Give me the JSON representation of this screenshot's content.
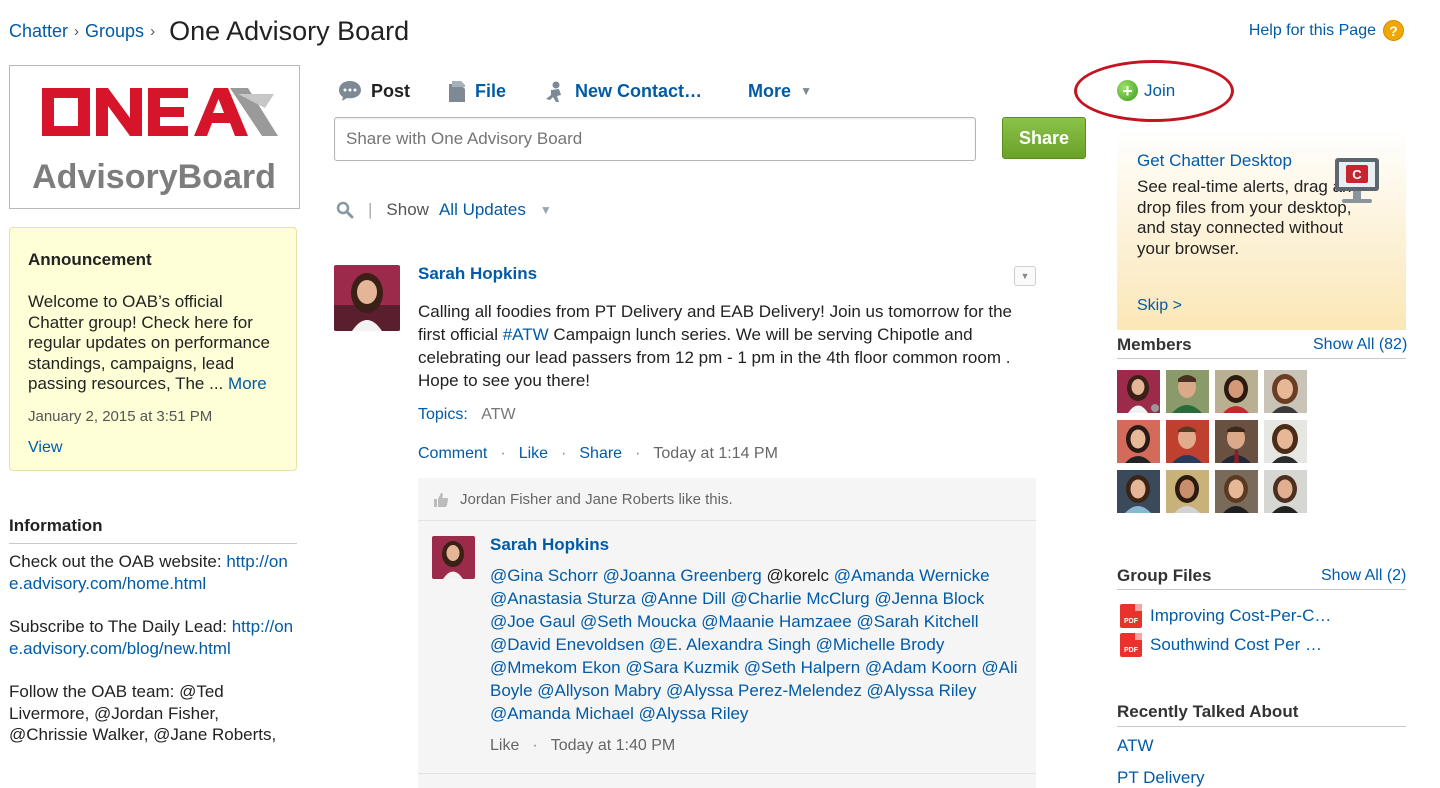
{
  "breadcrumb": {
    "chatter": "Chatter",
    "groups": "Groups",
    "title": "One Advisory Board"
  },
  "help": {
    "label": "Help for this Page"
  },
  "logo": {
    "top": "ONE",
    "bottom": "AdvisoryBoard",
    "colors": {
      "red": "#d7152a",
      "gray": "#7d7d7d"
    }
  },
  "announcement": {
    "heading": "Announcement",
    "body": "Welcome to OAB’s official Chatter group! Check here for regular updates on performance standings, campaigns, lead passing resources, The ...",
    "more": "More",
    "date": "January 2, 2015 at 3:51 PM",
    "view": "View"
  },
  "information": {
    "heading": "Information",
    "p1_text": "Check out the OAB website: ",
    "p1_link": "http://one.advisory.com/home.html",
    "p2_text": "Subscribe to The Daily Lead: ",
    "p2_link": "http://one.advisory.com/blog/new.html",
    "p3_text": "Follow the OAB team: @Ted Livermore, @Jordan Fisher, @Chrissie Walker, @Jane Roberts,"
  },
  "publisher": {
    "tabs": [
      "Post",
      "File",
      "New Contact…",
      "More"
    ],
    "placeholder": "Share with One Advisory Board",
    "share": "Share"
  },
  "filter": {
    "show": "Show",
    "value": "All Updates"
  },
  "post": {
    "author": "Sarah Hopkins",
    "text_before": "Calling all foodies from PT Delivery and EAB Delivery! Join us tomorrow for the first official ",
    "hashtag": "#ATW",
    "text_after": " Campaign lunch series. We will be serving Chipotle and celebrating our lead passers from 12 pm - 1 pm in the 4th floor common room . Hope to see you there!",
    "topics_label": "Topics:",
    "topic": "ATW",
    "actions": {
      "comment": "Comment",
      "like": "Like",
      "share": "Share",
      "time": "Today at 1:14 PM"
    },
    "likes": "Jordan Fisher and Jane Roberts like this."
  },
  "comment": {
    "author": "Sarah Hopkins",
    "mentions_a": "@Gina Schorr @Joanna Greenberg",
    "plain": " @korelc ",
    "mentions_b": "@Amanda Wernicke @Anastasia Sturza @Anne Dill @Charlie McClurg @Jenna Block @Joe Gaul @Seth Moucka @Maanie Hamzaee @Sarah Kitchell @David Enevoldsen @E. Alexandra Singh @Michelle Brody @Mmekom Ekon @Sara Kuzmik @Seth Halpern @Adam Koorn @Ali Boyle @Allyson Mabry @Alyssa Perez-Melendez @Alyssa Riley @Amanda Michael @Alyssa Riley",
    "like": "Like",
    "time": "Today at 1:40 PM"
  },
  "join": {
    "label": "Join"
  },
  "desktop": {
    "title": "Get Chatter Desktop",
    "text": "See real-time alerts, drag and drop files from your desktop, and stay connected without your browser.",
    "skip": "Skip >"
  },
  "members": {
    "title": "Members",
    "show_all": "Show All (82)"
  },
  "files": {
    "title": "Group Files",
    "show_all": "Show All (2)",
    "items": [
      "Improving Cost-Per-C…",
      "Southwind Cost Per …"
    ]
  },
  "recent": {
    "title": "Recently Talked About",
    "items": [
      "ATW",
      "PT Delivery"
    ]
  },
  "icons": [
    "chevron-right-icon",
    "help-icon",
    "post-bubble-icon",
    "file-icon",
    "new-contact-icon",
    "chevron-down-icon",
    "search-icon",
    "plus-icon",
    "monitor-icon",
    "pdf-icon",
    "thumbs-up-icon"
  ]
}
